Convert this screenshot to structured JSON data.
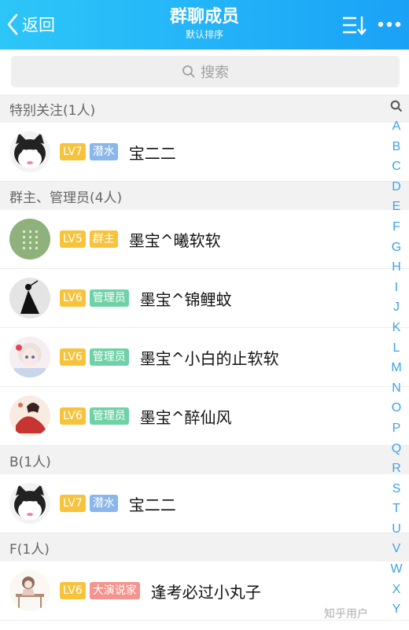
{
  "header": {
    "back_label": "返回",
    "title": "群聊成员",
    "subtitle": "默认排序",
    "sort_icon": "sort-list-icon",
    "more_icon": "more-dots-icon"
  },
  "search": {
    "placeholder": "搜索",
    "icon": "search-icon"
  },
  "sections": [
    {
      "title": "特别关注(1人)",
      "members": [
        {
          "avatar": "cat-avatar",
          "level": "LV7",
          "role": "潜水",
          "role_color": "#8ab6ea",
          "name": "宝二二"
        }
      ]
    },
    {
      "title": "群主、管理员(4人)",
      "members": [
        {
          "avatar": "green-pattern-avatar",
          "level": "LV5",
          "role": "群主",
          "role_color": "#f6c33a",
          "name": "墨宝^曦软软"
        },
        {
          "avatar": "silhouette-avatar",
          "level": "LV6",
          "role": "管理员",
          "role_color": "#6fd2a6",
          "name": "墨宝^锦鲤蚊"
        },
        {
          "avatar": "anime-girl-avatar",
          "level": "LV6",
          "role": "管理员",
          "role_color": "#6fd2a6",
          "name": "墨宝^小白的止软软"
        },
        {
          "avatar": "red-dress-avatar",
          "level": "LV6",
          "role": "管理员",
          "role_color": "#6fd2a6",
          "name": "墨宝^醉仙风"
        }
      ]
    },
    {
      "title": "B(1人)",
      "members": [
        {
          "avatar": "cat-avatar",
          "level": "LV7",
          "role": "潜水",
          "role_color": "#8ab6ea",
          "name": "宝二二"
        }
      ]
    },
    {
      "title": "F(1人)",
      "members": [
        {
          "avatar": "sketch-girl-avatar",
          "level": "LV6",
          "role": "大演说家",
          "role_color": "#f3948e",
          "name": "逢考必过小丸子"
        }
      ]
    }
  ],
  "index_bar": [
    "A",
    "B",
    "C",
    "D",
    "E",
    "F",
    "G",
    "H",
    "I",
    "J",
    "K",
    "L",
    "M",
    "N",
    "O",
    "P",
    "Q",
    "R",
    "S",
    "T",
    "U",
    "V",
    "W",
    "X",
    "Y"
  ],
  "watermark": "知乎用户",
  "colors": {
    "header_start": "#2dc6f8",
    "header_end": "#1aa2f7",
    "index": "#3da3e6",
    "level": "#f6c33a"
  }
}
